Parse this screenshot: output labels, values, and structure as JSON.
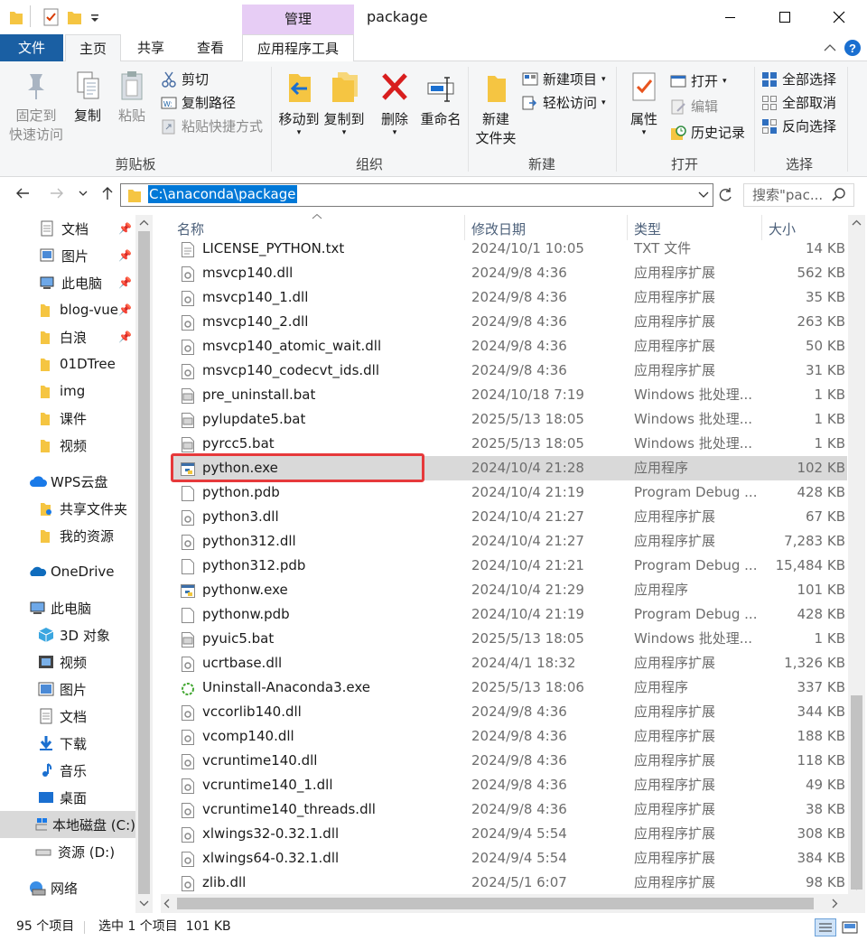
{
  "window": {
    "title": "package",
    "manage_tab": "管理"
  },
  "tabs": {
    "file": "文件",
    "home": "主页",
    "share": "共享",
    "view": "查看",
    "app_tools": "应用程序工具"
  },
  "ribbon": {
    "clipboard": {
      "pin_quick_access_line1": "固定到",
      "pin_quick_access_line2": "快速访问",
      "copy": "复制",
      "paste": "粘贴",
      "cut": "剪切",
      "copy_path": "复制路径",
      "paste_shortcut": "粘贴快捷方式",
      "group": "剪贴板"
    },
    "organize": {
      "move_to": "移动到",
      "copy_to": "复制到",
      "delete": "删除",
      "rename": "重命名",
      "group": "组织"
    },
    "new": {
      "new_folder_line1": "新建",
      "new_folder_line2": "文件夹",
      "new_item": "新建项目",
      "easy_access": "轻松访问",
      "group": "新建"
    },
    "open": {
      "properties": "属性",
      "open": "打开",
      "edit": "编辑",
      "history": "历史记录",
      "group": "打开"
    },
    "select": {
      "select_all": "全部选择",
      "select_none": "全部取消",
      "invert": "反向选择",
      "group": "选择"
    }
  },
  "address": {
    "path": "C:\\anaconda\\package",
    "search_placeholder": "搜索\"pac..."
  },
  "nav": {
    "quick": [
      {
        "label": "文档",
        "icon": "document-icon",
        "pinned": true
      },
      {
        "label": "图片",
        "icon": "picture-icon",
        "pinned": true
      },
      {
        "label": "此电脑",
        "icon": "computer-icon",
        "pinned": true
      },
      {
        "label": "blog-vue",
        "icon": "folder-icon",
        "pinned": true
      },
      {
        "label": "白浪",
        "icon": "folder-icon",
        "pinned": true
      },
      {
        "label": "01DTree",
        "icon": "folder-icon",
        "pinned": false
      },
      {
        "label": "img",
        "icon": "folder-icon",
        "pinned": false
      },
      {
        "label": "课件",
        "icon": "folder-icon",
        "pinned": false
      },
      {
        "label": "视频",
        "icon": "folder-icon",
        "pinned": false
      }
    ],
    "wps": "WPS云盘",
    "wps_items": [
      "共享文件夹",
      "我的资源"
    ],
    "onedrive": "OneDrive",
    "thispc": "此电脑",
    "pc_items": [
      {
        "label": "3D 对象",
        "icon": "3d-objects-icon"
      },
      {
        "label": "视频",
        "icon": "video-icon"
      },
      {
        "label": "图片",
        "icon": "picture-icon"
      },
      {
        "label": "文档",
        "icon": "document-icon"
      },
      {
        "label": "下载",
        "icon": "download-icon"
      },
      {
        "label": "音乐",
        "icon": "music-icon"
      },
      {
        "label": "桌面",
        "icon": "desktop-icon"
      },
      {
        "label": "本地磁盘 (C:)",
        "icon": "drive-c-icon"
      },
      {
        "label": "资源 (D:)",
        "icon": "drive-d-icon"
      }
    ],
    "network": "网络"
  },
  "columns": {
    "name": "名称",
    "date": "修改日期",
    "type": "类型",
    "size": "大小"
  },
  "files": [
    {
      "name": "LICENSE_PYTHON.txt",
      "date": "2024/10/1 10:05",
      "type": "TXT 文件",
      "size": "14 KB",
      "icon": "txt"
    },
    {
      "name": "msvcp140.dll",
      "date": "2024/9/8 4:36",
      "type": "应用程序扩展",
      "size": "562 KB",
      "icon": "dll"
    },
    {
      "name": "msvcp140_1.dll",
      "date": "2024/9/8 4:36",
      "type": "应用程序扩展",
      "size": "35 KB",
      "icon": "dll"
    },
    {
      "name": "msvcp140_2.dll",
      "date": "2024/9/8 4:36",
      "type": "应用程序扩展",
      "size": "263 KB",
      "icon": "dll"
    },
    {
      "name": "msvcp140_atomic_wait.dll",
      "date": "2024/9/8 4:36",
      "type": "应用程序扩展",
      "size": "50 KB",
      "icon": "dll"
    },
    {
      "name": "msvcp140_codecvt_ids.dll",
      "date": "2024/9/8 4:36",
      "type": "应用程序扩展",
      "size": "31 KB",
      "icon": "dll"
    },
    {
      "name": "pre_uninstall.bat",
      "date": "2024/10/18 7:19",
      "type": "Windows 批处理...",
      "size": "1 KB",
      "icon": "bat"
    },
    {
      "name": "pylupdate5.bat",
      "date": "2025/5/13 18:05",
      "type": "Windows 批处理...",
      "size": "1 KB",
      "icon": "bat"
    },
    {
      "name": "pyrcc5.bat",
      "date": "2025/5/13 18:05",
      "type": "Windows 批处理...",
      "size": "1 KB",
      "icon": "bat"
    },
    {
      "name": "python.exe",
      "date": "2024/10/4 21:28",
      "type": "应用程序",
      "size": "102 KB",
      "icon": "pyexe",
      "selected": true
    },
    {
      "name": "python.pdb",
      "date": "2024/10/4 21:19",
      "type": "Program Debug ...",
      "size": "428 KB",
      "icon": "blank"
    },
    {
      "name": "python3.dll",
      "date": "2024/10/4 21:27",
      "type": "应用程序扩展",
      "size": "67 KB",
      "icon": "dll"
    },
    {
      "name": "python312.dll",
      "date": "2024/10/4 21:27",
      "type": "应用程序扩展",
      "size": "7,283 KB",
      "icon": "dll"
    },
    {
      "name": "python312.pdb",
      "date": "2024/10/4 21:21",
      "type": "Program Debug ...",
      "size": "15,484 KB",
      "icon": "blank"
    },
    {
      "name": "pythonw.exe",
      "date": "2024/10/4 21:29",
      "type": "应用程序",
      "size": "101 KB",
      "icon": "pyexe"
    },
    {
      "name": "pythonw.pdb",
      "date": "2024/10/4 21:19",
      "type": "Program Debug ...",
      "size": "428 KB",
      "icon": "blank"
    },
    {
      "name": "pyuic5.bat",
      "date": "2025/5/13 18:05",
      "type": "Windows 批处理...",
      "size": "1 KB",
      "icon": "bat"
    },
    {
      "name": "ucrtbase.dll",
      "date": "2024/4/1 18:32",
      "type": "应用程序扩展",
      "size": "1,326 KB",
      "icon": "dll"
    },
    {
      "name": "Uninstall-Anaconda3.exe",
      "date": "2025/5/13 18:06",
      "type": "应用程序",
      "size": "337 KB",
      "icon": "anaconda"
    },
    {
      "name": "vccorlib140.dll",
      "date": "2024/9/8 4:36",
      "type": "应用程序扩展",
      "size": "344 KB",
      "icon": "dll"
    },
    {
      "name": "vcomp140.dll",
      "date": "2024/9/8 4:36",
      "type": "应用程序扩展",
      "size": "188 KB",
      "icon": "dll"
    },
    {
      "name": "vcruntime140.dll",
      "date": "2024/9/8 4:36",
      "type": "应用程序扩展",
      "size": "118 KB",
      "icon": "dll"
    },
    {
      "name": "vcruntime140_1.dll",
      "date": "2024/9/8 4:36",
      "type": "应用程序扩展",
      "size": "49 KB",
      "icon": "dll"
    },
    {
      "name": "vcruntime140_threads.dll",
      "date": "2024/9/8 4:36",
      "type": "应用程序扩展",
      "size": "38 KB",
      "icon": "dll"
    },
    {
      "name": "xlwings32-0.32.1.dll",
      "date": "2024/9/4 5:54",
      "type": "应用程序扩展",
      "size": "308 KB",
      "icon": "dll"
    },
    {
      "name": "xlwings64-0.32.1.dll",
      "date": "2024/9/4 5:54",
      "type": "应用程序扩展",
      "size": "384 KB",
      "icon": "dll"
    },
    {
      "name": "zlib.dll",
      "date": "2024/5/1 6:07",
      "type": "应用程序扩展",
      "size": "98 KB",
      "icon": "dll"
    }
  ],
  "status": {
    "count": "95 个项目",
    "selected": "选中 1 个项目  101 KB"
  },
  "colors": {
    "file_tab": "#1a5fa3",
    "manage_tab": "#e7cdf5",
    "selection": "#d9d9d9",
    "highlight_box": "#e6393b",
    "address_selection": "#0078d7"
  }
}
